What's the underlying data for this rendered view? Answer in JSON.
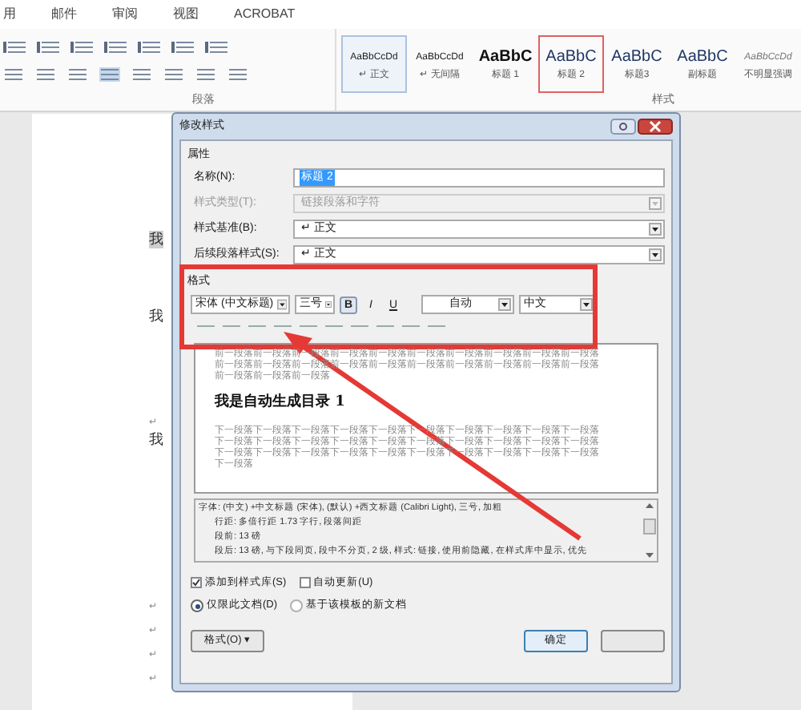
{
  "ribbon": {
    "tabs": [
      {
        "label": "用"
      },
      {
        "label": "邮件"
      },
      {
        "label": "审阅"
      },
      {
        "label": "视图"
      },
      {
        "label": "ACROBAT"
      }
    ],
    "groups": [
      {
        "label": "段落"
      },
      {
        "label": "样式"
      }
    ],
    "styles": [
      {
        "sample": "AaBbCcDd",
        "name": "↵ 正文",
        "kind": "body",
        "selected": true,
        "annotated": false
      },
      {
        "sample": "AaBbCcDd",
        "name": "↵ 无间隔",
        "kind": "body",
        "selected": false,
        "annotated": false
      },
      {
        "sample": "AaBbC",
        "name": "标题 1",
        "kind": "heading1",
        "selected": false,
        "annotated": false
      },
      {
        "sample": "AaBbC",
        "name": "标题 2",
        "kind": "heading",
        "selected": false,
        "annotated": true
      },
      {
        "sample": "AaBbC",
        "name": "标题3",
        "kind": "heading",
        "selected": false,
        "annotated": false
      },
      {
        "sample": "AaBbC",
        "name": "副标题",
        "kind": "heading",
        "selected": false,
        "annotated": false
      },
      {
        "sample": "AaBbCcDd",
        "name": "不明显强调",
        "kind": "subtle",
        "selected": false,
        "annotated": false
      }
    ]
  },
  "document": {
    "lines": [
      {
        "kind": "text",
        "text": "我",
        "selected": true
      },
      {
        "kind": "text",
        "text": "我",
        "selected": false
      },
      {
        "kind": "mark",
        "text": "↵",
        "selected": false
      },
      {
        "kind": "text",
        "text": "我",
        "selected": false
      },
      {
        "kind": "mark",
        "text": "↵",
        "selected": false
      },
      {
        "kind": "mark",
        "text": "↵",
        "selected": false
      },
      {
        "kind": "mark",
        "text": "↵",
        "selected": false
      },
      {
        "kind": "mark",
        "text": "↵",
        "selected": false
      }
    ]
  },
  "dialog": {
    "title": "修改样式",
    "properties": {
      "heading": "属性",
      "fields": [
        {
          "label": "名称(N):",
          "value": "标题 2",
          "kind": "text",
          "disabled": false
        },
        {
          "label": "样式类型(T):",
          "value": "链接段落和字符",
          "kind": "select",
          "disabled": true
        },
        {
          "label": "样式基准(B):",
          "value": "↵ 正文",
          "kind": "select",
          "disabled": false
        },
        {
          "label": "后续段落样式(S):",
          "value": "↵ 正文",
          "kind": "select",
          "disabled": false
        }
      ]
    },
    "format": {
      "heading": "格式",
      "font": "宋体 (中文标题)",
      "size": "三号",
      "bold": true,
      "italic": false,
      "underline": false,
      "bold_label": "B",
      "italic_label": "I",
      "underline_label": "U",
      "font_color": "自动",
      "language": "中文"
    },
    "preview": {
      "before": [
        "前一段落前一段落前一段落前一段落前一段落前一段落前一段落前一段落前一段落前一段落",
        "前一段落前一段落前一段落前一段落前一段落前一段落前一段落前一段落前一段落前一段落",
        "前一段落前一段落前一段落"
      ],
      "heading": "我是自动生成目录 1",
      "after": [
        "下一段落下一段落下一段落下一段落下一段落下一段落下一段落下一段落下一段落下一段落",
        "下一段落下一段落下一段落下一段落下一段落下一段落下一段落下一段落下一段落下一段落",
        "下一段落下一段落下一段落下一段落下一段落下一段落下一段落下一段落下一段落下一段落",
        "下一段落"
      ]
    },
    "description": [
      "字体: (中文) +中文标题 (宋体), (默认) +西文标题 (Calibri Light), 三号, 加粗",
      "行距: 多倍行距 1.73 字行, 段落间距",
      "段前: 13 磅",
      "段后: 13 磅, 与下段同页, 段中不分页, 2 级, 样式: 链接, 使用前隐藏, 在样式库中显示, 优先"
    ],
    "checkboxes": [
      {
        "label": "添加到样式库(S)",
        "checked": true
      },
      {
        "label": "自动更新(U)",
        "checked": false
      }
    ],
    "radios": [
      {
        "label": "仅限此文档(D)",
        "selected": true
      },
      {
        "label": "基于该模板的新文档",
        "selected": false
      }
    ],
    "format_button": "格式(O) ▾",
    "ok_button": "确定"
  }
}
